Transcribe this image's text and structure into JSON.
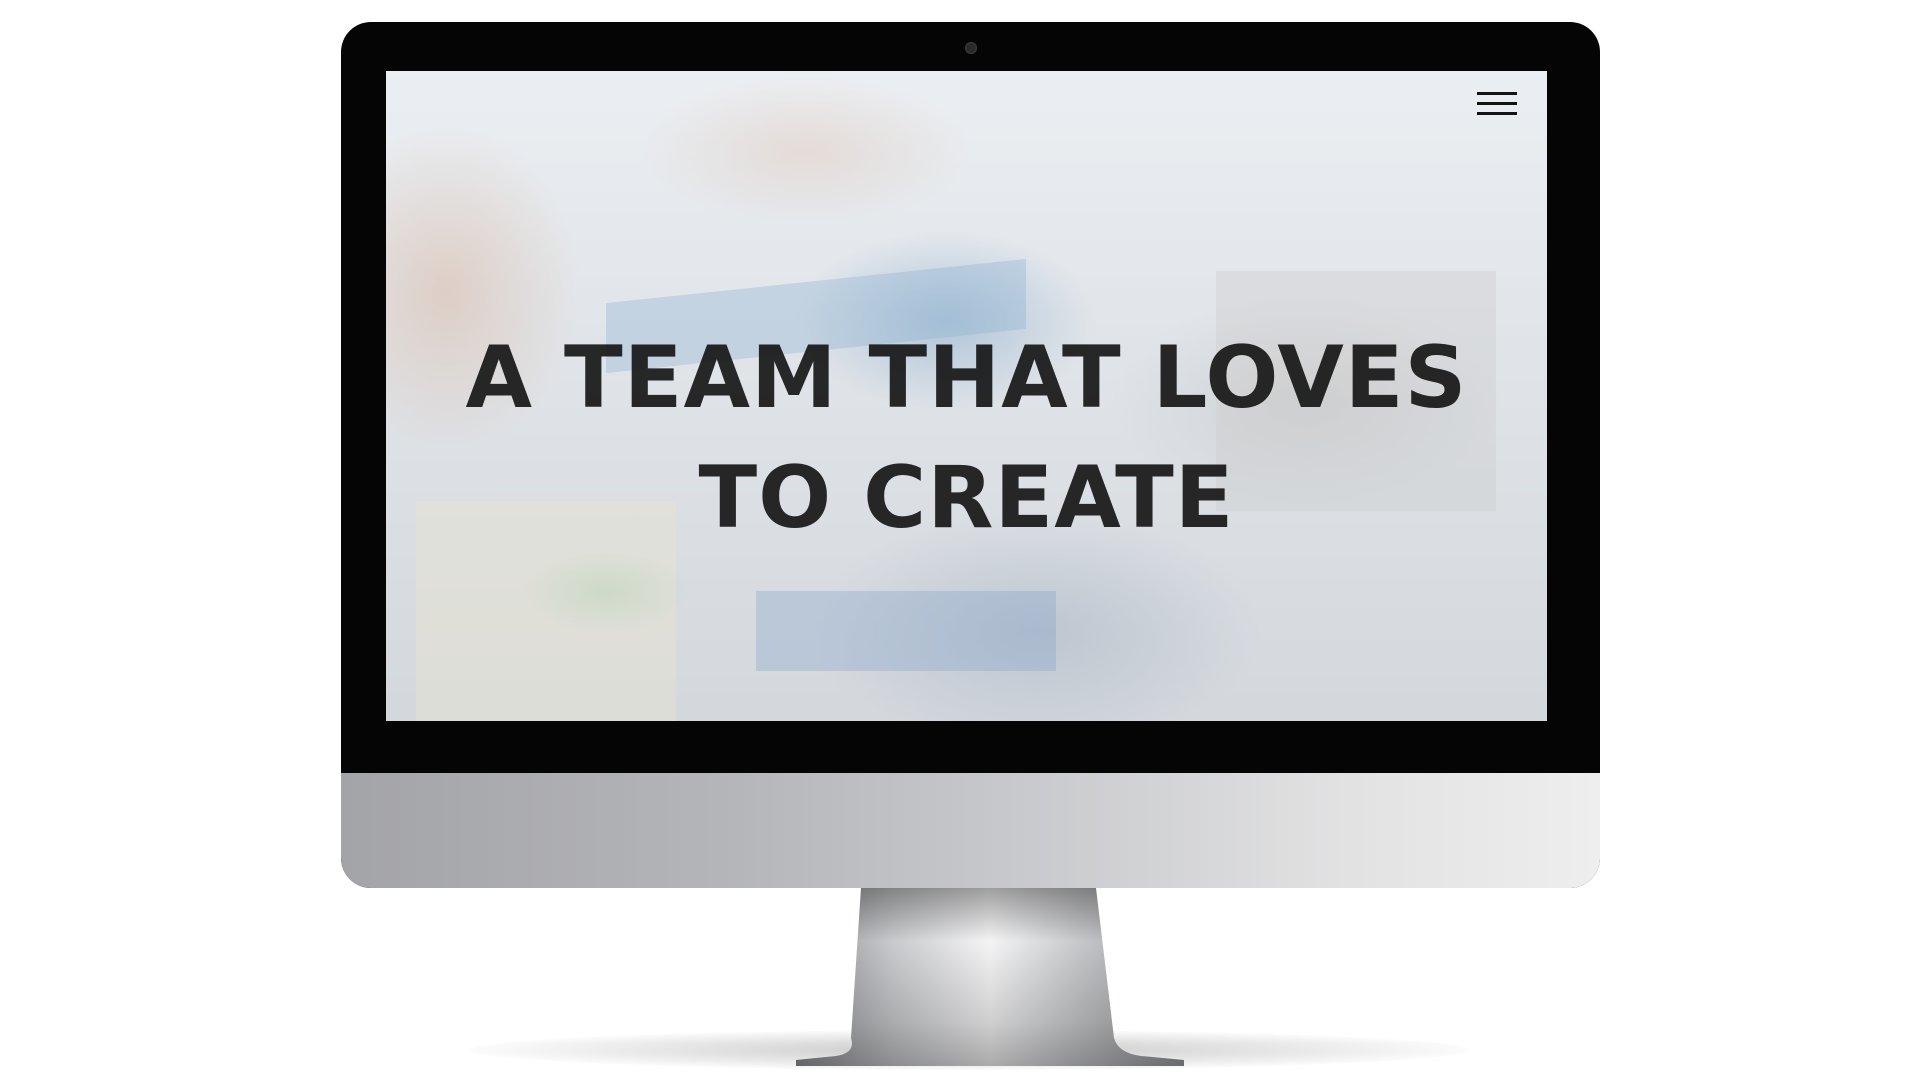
{
  "hero": {
    "line1": "A TEAM THAT LOVES",
    "line2": "TO CREATE"
  },
  "nav": {
    "menu_icon": "hamburger-menu-icon"
  },
  "colors": {
    "bezel": "#050505",
    "chin": "#b4b5b9",
    "title": "#121212"
  }
}
